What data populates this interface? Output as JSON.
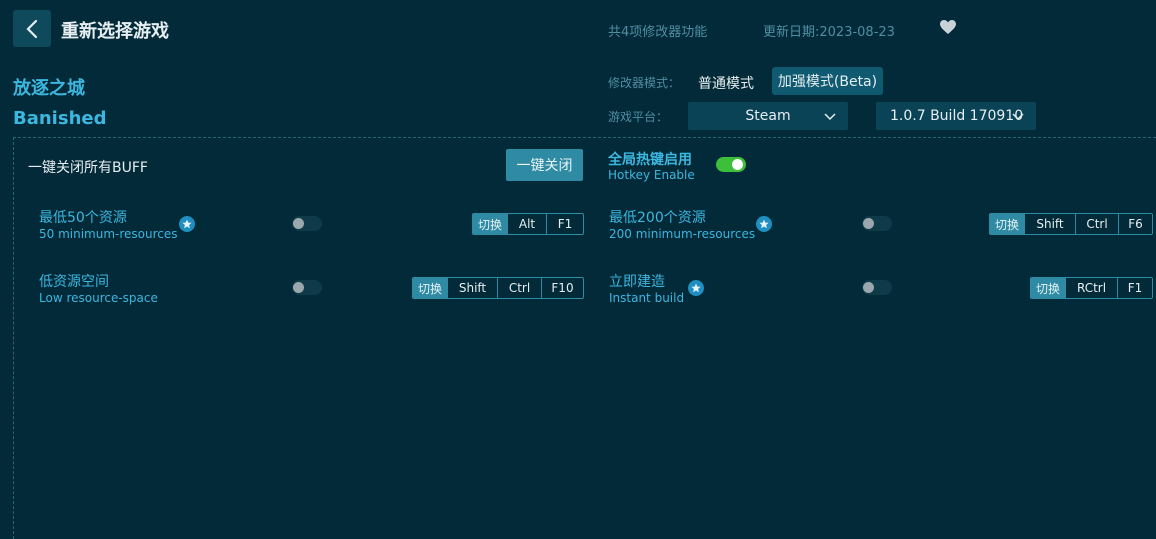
{
  "header": {
    "title": "重新选择游戏",
    "feature_count": "共4项修改器功能",
    "update_date": "更新日期:2023-08-23"
  },
  "game": {
    "name_cn": "放逐之城",
    "name_en": "Banished"
  },
  "mode": {
    "label": "修改器模式：",
    "normal": "普通模式",
    "beta": "加强模式(Beta)"
  },
  "platform": {
    "label": "游戏平台：",
    "selected": "Steam",
    "version": "1.0.7 Build 170910"
  },
  "controls": {
    "buff_label": "一键关闭所有BUFF",
    "close_all": "一键关闭",
    "hotkey_cn": "全局热键启用",
    "hotkey_en": "Hotkey Enable",
    "hotkey_enabled": true
  },
  "features": [
    {
      "name_cn": "最低50个资源",
      "name_en": "50 minimum-resources",
      "starred": true,
      "enabled": false,
      "switch": "切换",
      "keys": [
        "Alt",
        "F1"
      ]
    },
    {
      "name_cn": "最低200个资源",
      "name_en": "200 minimum-resources",
      "starred": true,
      "enabled": false,
      "switch": "切换",
      "keys": [
        "Shift",
        "Ctrl",
        "F6"
      ]
    },
    {
      "name_cn": "低资源空间",
      "name_en": "Low resource-space",
      "starred": false,
      "enabled": false,
      "switch": "切换",
      "keys": [
        "Shift",
        "Ctrl",
        "F10"
      ]
    },
    {
      "name_cn": "立即建造",
      "name_en": "Instant build",
      "starred": true,
      "enabled": false,
      "switch": "切换",
      "keys": [
        "RCtrl",
        "F1"
      ]
    }
  ],
  "colors": {
    "background": "#022a38",
    "accent": "#3cb7e0",
    "button": "#2f8aa3",
    "toggle_on": "#3cc03c"
  }
}
